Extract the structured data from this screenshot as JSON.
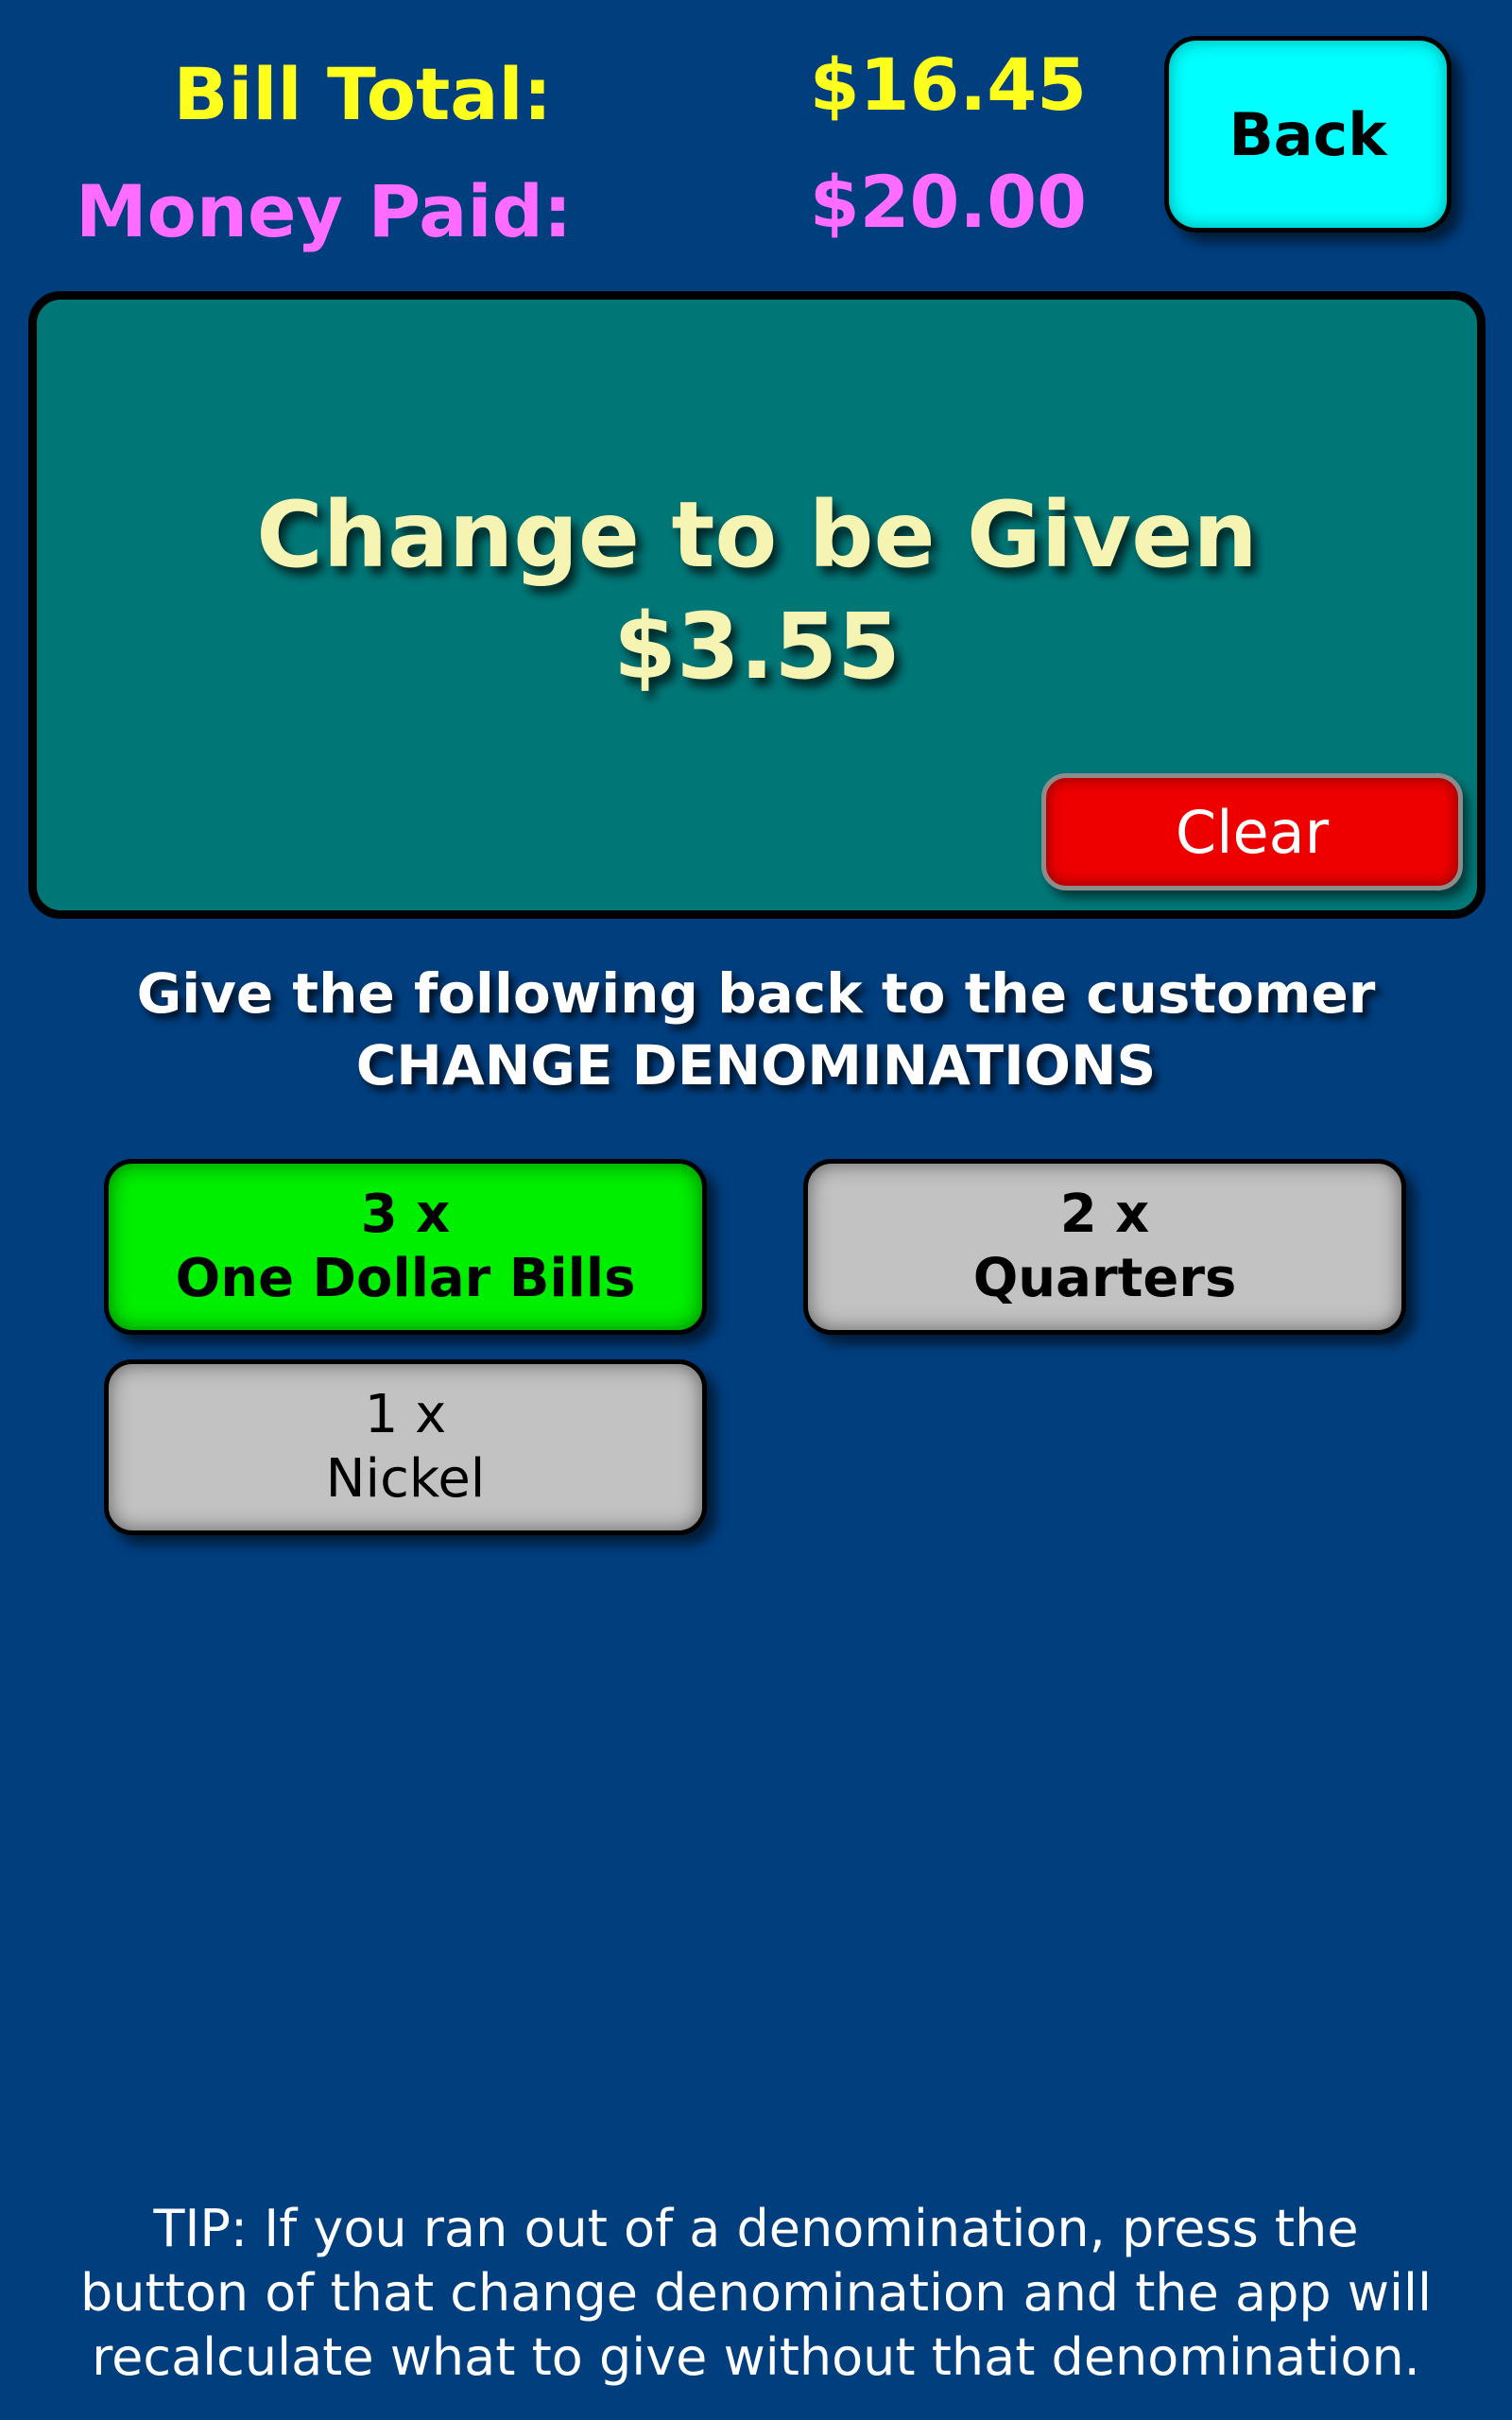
{
  "summary": {
    "bill_total_label": "Bill Total:",
    "bill_total_value": "$16.45",
    "money_paid_label": "Money Paid:",
    "money_paid_value": "$20.00"
  },
  "back_button": {
    "label": "Back"
  },
  "change_panel": {
    "title": "Change to be Given",
    "amount": "$3.55",
    "clear_label": "Clear"
  },
  "instructions": {
    "line1": "Give the following back to the customer",
    "line2": "CHANGE DENOMINATIONS"
  },
  "denominations": [
    {
      "count": "3 x",
      "name": "One Dollar Bills",
      "state": "selected"
    },
    {
      "count": "2 x",
      "name": "Quarters",
      "state": "normal"
    },
    {
      "count": "1 x",
      "name": "Nickel",
      "state": "normal"
    }
  ],
  "tip": {
    "line1": "TIP: If you ran out of a denomination, press the",
    "line2": "button of that change denomination and the app will",
    "line3": "recalculate what to give without that denomination."
  },
  "colors": {
    "background": "#003e7e",
    "bill_total": "#ffff1e",
    "money_paid": "#ff6cff",
    "back_button": "#00ffff",
    "panel": "#007777",
    "clear_button": "#ee0000",
    "denom_selected": "#00ee00",
    "denom_normal": "#c2c2c2"
  }
}
